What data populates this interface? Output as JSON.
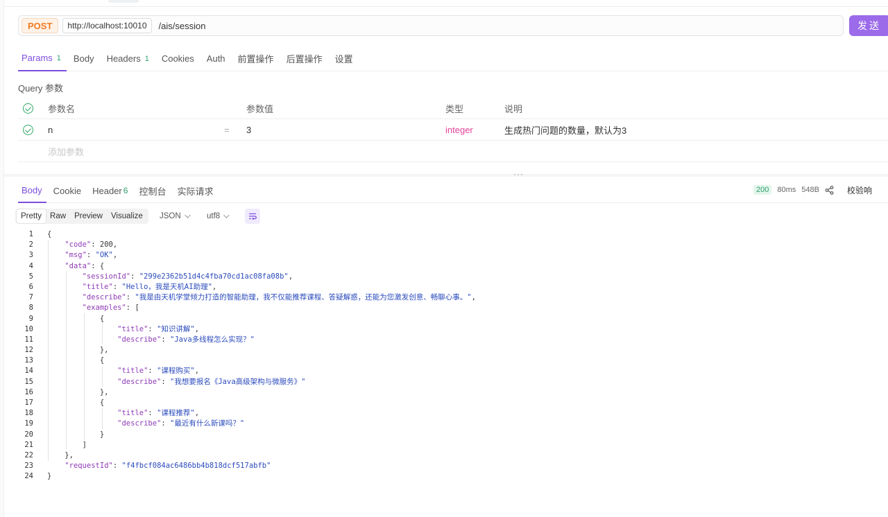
{
  "request": {
    "method": "POST",
    "host": "http://localhost:10010",
    "path": "/ais/session",
    "send_label": "发送"
  },
  "req_tabs": [
    {
      "label": "Params",
      "count": "1"
    },
    {
      "label": "Body",
      "count": ""
    },
    {
      "label": "Headers",
      "count": "1"
    },
    {
      "label": "Cookies",
      "count": ""
    },
    {
      "label": "Auth",
      "count": ""
    },
    {
      "label": "前置操作",
      "count": ""
    },
    {
      "label": "后置操作",
      "count": ""
    },
    {
      "label": "设置",
      "count": ""
    }
  ],
  "query": {
    "label": "Query 参数",
    "headers": {
      "name": "参数名",
      "value": "参数值",
      "type": "类型",
      "desc": "说明"
    },
    "rows": [
      {
        "name": "n",
        "eq": "=",
        "value": "3",
        "type": "integer",
        "desc": "生成热门问题的数量，默认为3"
      }
    ],
    "add_placeholder": "添加参数"
  },
  "resp_tabs": [
    {
      "label": "Body",
      "count": ""
    },
    {
      "label": "Cookie",
      "count": ""
    },
    {
      "label": "Header",
      "count": "6"
    },
    {
      "label": "控制台",
      "count": ""
    },
    {
      "label": "实际请求",
      "count": ""
    }
  ],
  "status": {
    "code": "200",
    "time": "80ms",
    "size": "548B",
    "verify": "校验响"
  },
  "view_modes": [
    "Pretty",
    "Raw",
    "Preview",
    "Visualize"
  ],
  "format": "JSON",
  "encoding": "utf8",
  "code_lines": [
    "{",
    "    \"code\": 200,",
    "    \"msg\": \"OK\",",
    "    \"data\": {",
    "        \"sessionId\": \"299e2362b51d4c4fba70cd1ac08fa08b\",",
    "        \"title\": \"Hello，我是天机AI助理\",",
    "        \"describe\": \"我是由天机学堂倾力打造的智能助理，我不仅能推荐课程、答疑解惑，还能为您激发创意、畅聊心事。\",",
    "        \"examples\": [",
    "            {",
    "                \"title\": \"知识讲解\",",
    "                \"describe\": \"Java多线程怎么实现？\"",
    "            },",
    "            {",
    "                \"title\": \"课程购买\",",
    "                \"describe\": \"我想要报名《Java高级架构与微服务》\"",
    "            },",
    "            {",
    "                \"title\": \"课程推荐\",",
    "                \"describe\": \"最近有什么新课吗？\"",
    "            }",
    "        ]",
    "    },",
    "    \"requestId\": \"f4fbcf084ac6486bb4b818dcf517abfb\"",
    "}"
  ],
  "colors": {
    "accent": "#7b4ee0",
    "send": "#9b6bea",
    "method": "#f07c23",
    "success": "#2fa06b",
    "type": "#e0439a"
  }
}
